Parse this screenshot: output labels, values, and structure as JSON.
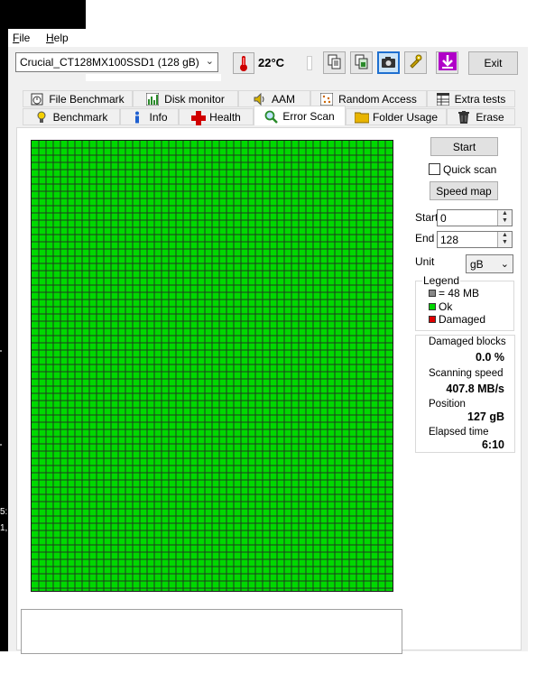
{
  "menu": {
    "file": "File",
    "file_key": "F",
    "file_rest": "ile",
    "help_key": "H",
    "help_rest": "elp"
  },
  "toolbar": {
    "drive": "Crucial_CT128MX100SSD1 (128 gB)",
    "temperature": "22°C",
    "exit_label": "Exit"
  },
  "tabs_top": [
    {
      "label": "File Benchmark",
      "icon": "stopwatch-icon"
    },
    {
      "label": "Disk monitor",
      "icon": "bar-chart-icon"
    },
    {
      "label": "AAM",
      "icon": "speaker-icon"
    },
    {
      "label": "Random Access",
      "icon": "dots-grid-icon"
    },
    {
      "label": "Extra tests",
      "icon": "table-icon"
    }
  ],
  "tabs_bottom": [
    {
      "label": "Benchmark",
      "icon": "bulb-icon"
    },
    {
      "label": "Info",
      "icon": "info-icon"
    },
    {
      "label": "Health",
      "icon": "cross-icon"
    },
    {
      "label": "Error Scan",
      "icon": "magnifier-icon",
      "active": true
    },
    {
      "label": "Folder Usage",
      "icon": "folder-icon"
    },
    {
      "label": "Erase",
      "icon": "trash-icon"
    }
  ],
  "scan": {
    "start_button": "Start",
    "quick_scan_label": "Quick scan",
    "speed_map_button": "Speed map",
    "start_label": "Start",
    "start_value": "0",
    "end_label": "End",
    "end_value": "128",
    "unit_label": "Unit",
    "unit_value": "gB",
    "grid_color": "#00d800",
    "grid_status": "Ok"
  },
  "legend": {
    "title": "Legend",
    "block_size": "= 48 MB",
    "ok": "Ok",
    "damaged": "Damaged",
    "ok_color": "#00d800",
    "damaged_color": "#e00000"
  },
  "stats": {
    "damaged_blocks_label": "Damaged blocks",
    "damaged_blocks_value": "0.0 %",
    "scanning_speed_label": "Scanning speed",
    "scanning_speed_value": "407.8 MB/s",
    "position_label": "Position",
    "position_value": "127 gB",
    "elapsed_label": "Elapsed time",
    "elapsed_value": "6:10"
  },
  "desktop": {
    "text1": "5:",
    "text2": "1,"
  }
}
